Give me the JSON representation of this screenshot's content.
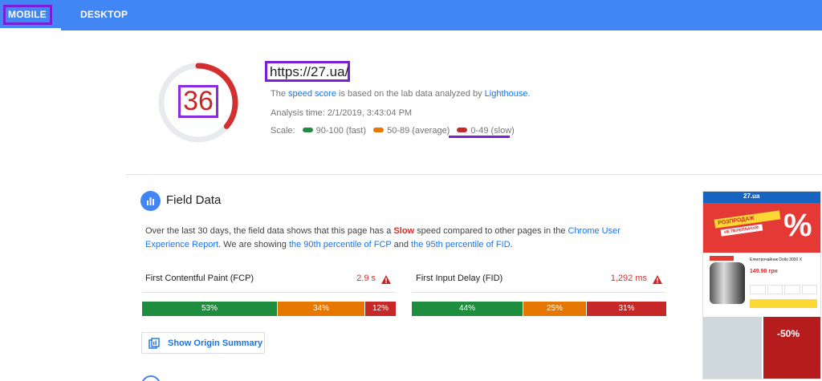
{
  "tabs": {
    "mobile": "MOBILE",
    "desktop": "DESKTOP"
  },
  "summary": {
    "score": "36",
    "score_fraction": 0.36,
    "url": "https://27.ua/",
    "line1_pre": "The ",
    "line1_link": "speed score",
    "line1_mid": " is based on the lab data analyzed by ",
    "line1_link2": "Lighthouse",
    "line1_post": ".",
    "analysis_time": "Analysis time: 2/1/2019, 3:43:04 PM",
    "scale_label": "Scale:",
    "scale_fast": "90-100 (fast)",
    "scale_average": "50-89 (average)",
    "scale_slow": "0-49 (slow)"
  },
  "field_data": {
    "title": "Field Data",
    "desc_1": "Over the last 30 days, the field data shows that this page has a ",
    "desc_slow": "Slow",
    "desc_2": " speed compared to other pages in the ",
    "desc_link1": "Chrome User Experience Report",
    "desc_3": ". We are showing ",
    "desc_link2": "the 90th percentile of FCP",
    "desc_4": " and ",
    "desc_link3": "the 95th percentile of FID",
    "desc_5": ".",
    "fcp": {
      "label": "First Contentful Paint (FCP)",
      "value": "2.9 s",
      "dist": [
        53,
        34,
        12
      ],
      "dist_labels": [
        "53%",
        "34%",
        "12%"
      ]
    },
    "fid": {
      "label": "First Input Delay (FID)",
      "value": "1,292 ms",
      "dist": [
        44,
        25,
        31
      ],
      "dist_labels": [
        "44%",
        "25%",
        "31%"
      ]
    },
    "origin_button": "Show Origin Summary"
  },
  "phone": {
    "logo": "27.ua",
    "banner_line1": "РОЗПРОДАЖ",
    "banner_line2": "НЕ ПЕРЕПЛАЧУЙ!",
    "banner_pct": "%",
    "product_name": "Електрочайник Dollo 3000 X",
    "product_price": "149.98 грн",
    "promo": "-50%"
  },
  "colors": {
    "brand_blue": "#4285f4",
    "fast": "#1e8e3e",
    "average": "#e67700",
    "slow": "#c62828",
    "highlight": "#7b1fd6"
  }
}
